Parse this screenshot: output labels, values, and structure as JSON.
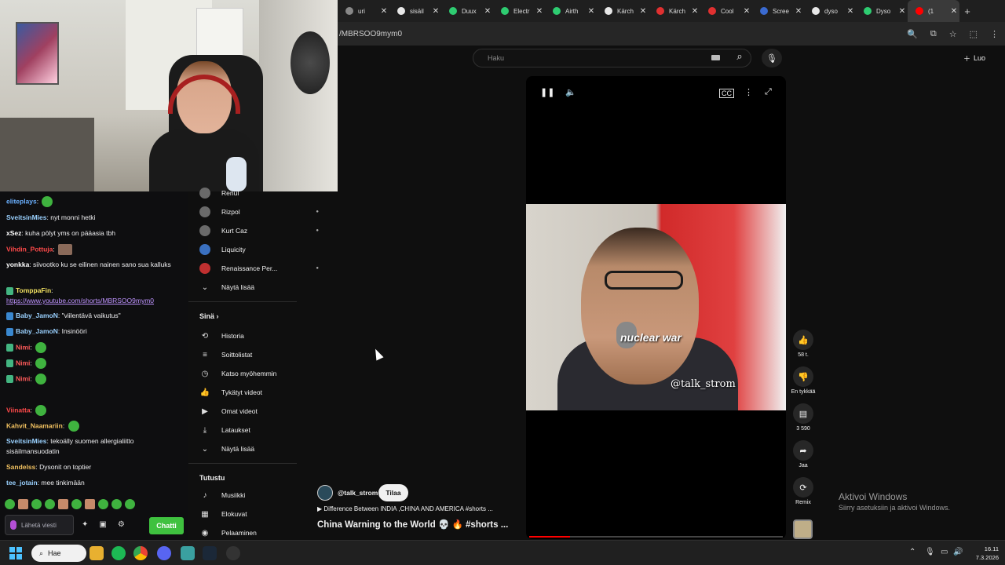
{
  "browser": {
    "tabs": [
      {
        "label": "uri",
        "color": "#888888"
      },
      {
        "label": "sisäil",
        "color": "#e8e8e8"
      },
      {
        "label": "Duux",
        "color": "#2ecc71"
      },
      {
        "label": "Electr",
        "color": "#2ecc71"
      },
      {
        "label": "Airth",
        "color": "#2ecc71"
      },
      {
        "label": "Kärch",
        "color": "#e8e8e8"
      },
      {
        "label": "Kärch",
        "color": "#e03030"
      },
      {
        "label": "Cool",
        "color": "#e03030"
      },
      {
        "label": "Scree",
        "color": "#3a6ad0"
      },
      {
        "label": "dyso",
        "color": "#e8e8e8"
      },
      {
        "label": "Dyso",
        "color": "#2ecc71"
      },
      {
        "label": "(1",
        "color": "#ff0000"
      }
    ],
    "url": "/MBRSOO9mym0"
  },
  "chat": {
    "messages": [
      {
        "user": "eliteplays",
        "color": "#6ab0ff",
        "text": ""
      },
      {
        "user": "SveitsinMies",
        "color": "#9ad1ff",
        "text": "nyt monni hetki"
      },
      {
        "user": "xSez",
        "color": "#ffffff",
        "text": "kuha pölyt yms on pääasia tbh"
      },
      {
        "user": "Vihdin_Pottuja",
        "color": "#ff4a4a",
        "text": ""
      },
      {
        "user": "yonkka",
        "color": "#ffffff",
        "text": "siivootko ku se eilinen nainen sano sua kalluks"
      },
      {
        "user": "TomppaFin",
        "color": "#f0e060",
        "text": "https://www.youtube.com/shorts/MBRSOO9mym0"
      },
      {
        "user": "Baby_JamoN",
        "color": "#9ad1ff",
        "text": "\"viilentävä vaikutus\""
      },
      {
        "user": "Baby_JamoN",
        "color": "#9ad1ff",
        "text": "Insinööri"
      },
      {
        "user": "Nimi",
        "color": "#ff5a5a",
        "text": ""
      },
      {
        "user": "Nimi",
        "color": "#ff5a5a",
        "text": ""
      },
      {
        "user": "Nimi",
        "color": "#ff5a5a",
        "text": ""
      },
      {
        "user": "Viinatta",
        "color": "#ff4a4a",
        "text": ""
      },
      {
        "user": "Kahvit_Naamariin",
        "color": "#f0c060",
        "text": ""
      },
      {
        "user": "SveitsinMies",
        "color": "#9ad1ff",
        "text": "tekoälly suomen allergialiitto sisäilmansuodatin"
      },
      {
        "user": "Sandelss",
        "color": "#f0c060",
        "text": "Dysonit on toptier"
      },
      {
        "user": "tee_jotain",
        "color": "#9ad1ff",
        "text": "mee tinkimään"
      }
    ],
    "input_placeholder": "Lähetä viesti",
    "send_label": "Chatti"
  },
  "sidebar": {
    "partial_top": "Renul",
    "subscriptions": [
      {
        "label": "Rizpol",
        "new": true
      },
      {
        "label": "Kurt Caz",
        "new": true
      },
      {
        "label": "Liquicity",
        "new": false
      },
      {
        "label": "Renaissance Per...",
        "new": true
      }
    ],
    "show_more": "Näytä lisää",
    "you_header": "Sinä",
    "you_items": [
      {
        "label": "Historia",
        "icon": "history-icon",
        "glyph": "⟲"
      },
      {
        "label": "Soittolistat",
        "icon": "playlists-icon",
        "glyph": "≡"
      },
      {
        "label": "Katso myöhemmin",
        "icon": "watch-later-icon",
        "glyph": "◷"
      },
      {
        "label": "Tykätyt videot",
        "icon": "liked-videos-icon",
        "glyph": "👍"
      },
      {
        "label": "Omat videot",
        "icon": "your-videos-icon",
        "glyph": "▶"
      },
      {
        "label": "Lataukset",
        "icon": "downloads-icon",
        "glyph": "⤓"
      }
    ],
    "show_more_2": "Näytä lisää",
    "explore_header": "Tutustu",
    "explore_items": [
      {
        "label": "Musiikki",
        "icon": "music-icon",
        "glyph": "♪"
      },
      {
        "label": "Elokuvat",
        "icon": "movies-icon",
        "glyph": "▦"
      },
      {
        "label": "Pelaaminen",
        "icon": "gaming-icon",
        "glyph": "◉"
      }
    ]
  },
  "topbar": {
    "search_placeholder": "Haku",
    "create_label": "Luo"
  },
  "video": {
    "caption": "nuclear war",
    "watermark": "@talk_strom",
    "progress": 0.16,
    "likes": "58 t.",
    "dislike_label": "En tykkää",
    "comments": "3 590",
    "share_label": "Jaa",
    "remix_label": "Remix",
    "channel": "@talk_strom",
    "subscribe_label": "Tilaa",
    "playlist": "Difference Between INDIA ,CHINA AND AMERICA #shorts ...",
    "title": "China Warning to the World 💀 🔥 #shorts ..."
  },
  "watermark_windows": {
    "line1": "Aktivoi Windows",
    "line2": "Siirry asetuksiin ja aktivoi Windows."
  },
  "taskbar": {
    "search_label": "Hae",
    "time": "16.11",
    "date": "7.3.2026"
  }
}
